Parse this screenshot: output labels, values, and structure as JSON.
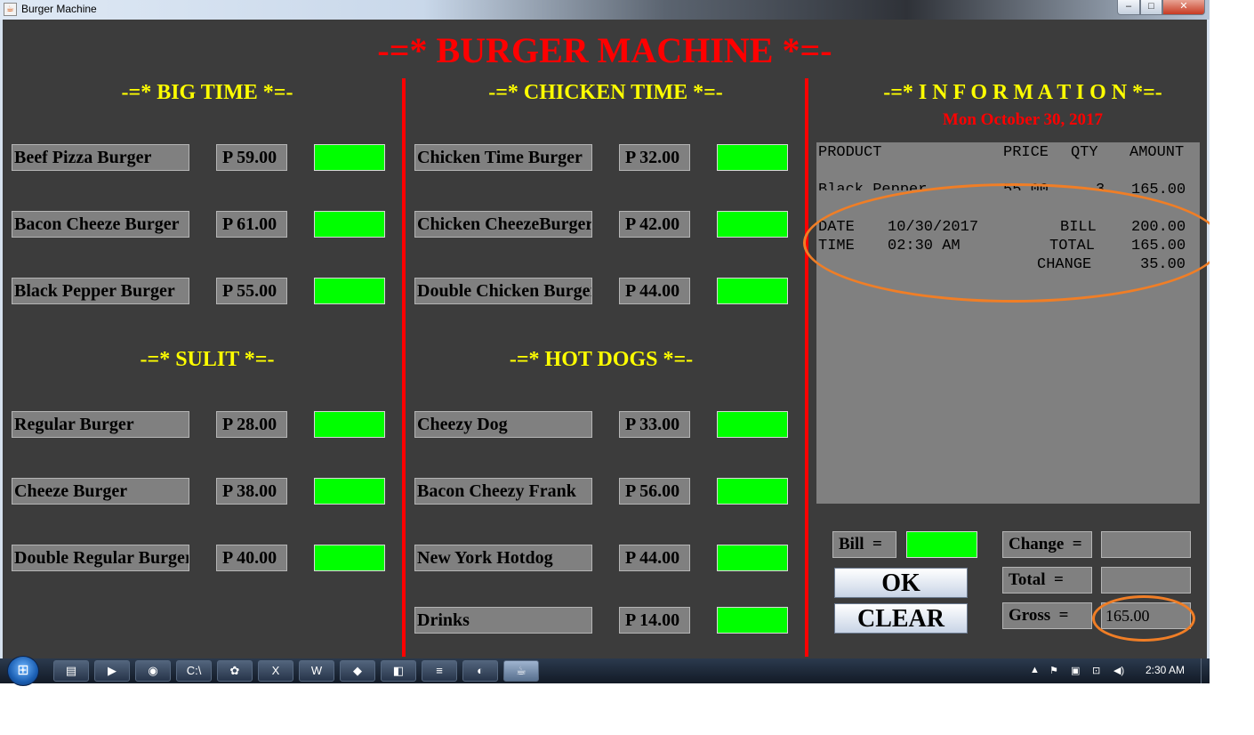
{
  "window": {
    "title": "Burger Machine",
    "controls": {
      "minimize": "–",
      "maximize": "□",
      "close": "✕"
    }
  },
  "app_title": "-=* BURGER MACHINE *=-",
  "colors": {
    "background": "#3c3c3c",
    "title_red": "#ff0000",
    "section_yellow": "#ffff00",
    "quantity_green": "#00ff00",
    "annotation_orange": "#f07e26"
  },
  "sections": {
    "big_time": {
      "title": "-=* BIG TIME *=-",
      "items": [
        {
          "name": "Beef Pizza Burger",
          "price": "P 59.00"
        },
        {
          "name": "Bacon Cheeze Burger",
          "price": "P 61.00"
        },
        {
          "name": "Black Pepper Burger",
          "price": "P 55.00"
        }
      ]
    },
    "sulit": {
      "title": "-=* SULIT *=-",
      "items": [
        {
          "name": "Regular Burger",
          "price": "P 28.00"
        },
        {
          "name": "Cheeze Burger",
          "price": "P 38.00"
        },
        {
          "name": "Double Regular Burger",
          "price": "P 40.00"
        }
      ]
    },
    "chicken_time": {
      "title": "-=* CHICKEN TIME *=-",
      "items": [
        {
          "name": "Chicken Time Burger",
          "price": "P 32.00"
        },
        {
          "name": "Chicken CheezeBurger",
          "price": "P 42.00"
        },
        {
          "name": "Double Chicken Burger",
          "price": "P 44.00"
        }
      ]
    },
    "hot_dogs": {
      "title": "-=* HOT DOGS *=-",
      "items": [
        {
          "name": "Cheezy Dog",
          "price": "P 33.00"
        },
        {
          "name": "Bacon Cheezy Frank",
          "price": "P 56.00"
        },
        {
          "name": "New York Hotdog",
          "price": "P 44.00"
        },
        {
          "name": "Drinks",
          "price": "P 14.00"
        }
      ]
    }
  },
  "information": {
    "title": "-=* I N F O R M A T I O N *=-",
    "date": "Mon October 30, 2017",
    "receipt": {
      "headers": {
        "product": "PRODUCT",
        "price": "PRICE",
        "qty": "QTY",
        "amount": "AMOUNT"
      },
      "line": {
        "product": "Black Pepper",
        "price": "55.00",
        "qty": "3",
        "amount": "165.00"
      },
      "date_label": "DATE",
      "date_value": "10/30/2017",
      "time_label": "TIME",
      "time_value": "02:30 AM",
      "bill_label": "BILL",
      "bill_value": "200.00",
      "total_label": "TOTAL",
      "total_value": "165.00",
      "change_label": "CHANGE",
      "change_value": "35.00"
    }
  },
  "payment": {
    "bill_label": "Bill  =",
    "bill_value": "",
    "change_label": "Change  =",
    "change_value": "",
    "total_label": "Total  =",
    "total_value": "",
    "gross_label": "Gross  =",
    "gross_value": "165.00",
    "ok_button": "OK",
    "clear_button": "CLEAR"
  },
  "taskbar": {
    "start_icon": "windows-logo-icon",
    "apps": [
      {
        "icon": "file-explorer-icon",
        "glyph": "▤"
      },
      {
        "icon": "media-player-icon",
        "glyph": "▶"
      },
      {
        "icon": "chrome-icon",
        "glyph": "◉"
      },
      {
        "icon": "command-prompt-icon",
        "glyph": "C:\\"
      },
      {
        "icon": "app-green-icon",
        "glyph": "✿"
      },
      {
        "icon": "excel-icon",
        "glyph": "X"
      },
      {
        "icon": "word-icon",
        "glyph": "W"
      },
      {
        "icon": "app-diamond-icon",
        "glyph": "◆"
      },
      {
        "icon": "app-folder-icon",
        "glyph": "◧"
      },
      {
        "icon": "notepad-icon",
        "glyph": "≡"
      },
      {
        "icon": "paint-icon",
        "glyph": "◐"
      },
      {
        "icon": "java-app-icon",
        "glyph": "☕"
      }
    ],
    "tray": {
      "expand": "▲",
      "flag": "⚑",
      "device": "▣",
      "network": "⊡",
      "volume": "◀)"
    },
    "clock": "2:30 AM"
  }
}
